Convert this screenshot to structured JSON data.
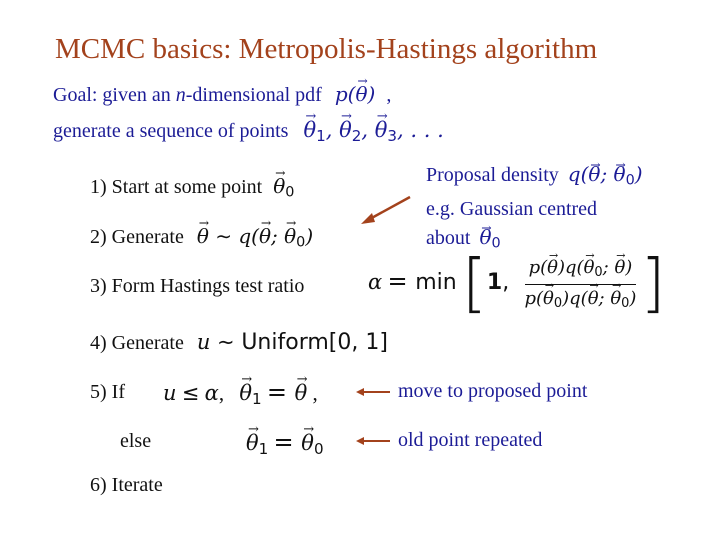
{
  "title": "MCMC basics:  Metropolis-Hastings algorithm",
  "goal": {
    "line1_prefix": "Goal:  given an ",
    "line1_n": "n",
    "line1_suffix": "-dimensional pdf",
    "line1_math": "p(θ)",
    "line1_comma": ",",
    "line2_text": "generate a sequence of points",
    "line2_math": "θ1, θ2, θ3, . . ."
  },
  "steps": [
    {
      "label": "1)  Start at some point",
      "math": "θ0"
    },
    {
      "label": "2)  Generate",
      "math": "θ ~ q(θ; θ0)"
    },
    {
      "label": "3)  Form Hastings test ratio",
      "math": "α = min[1, p(θ)q(θ0; θ) / p(θ0)q(θ; θ0)]"
    },
    {
      "label": "4)  Generate",
      "math": "u ~ Uniform[0, 1]"
    },
    {
      "label": "5)  If",
      "math": "u ≤ α,  θ1 = θ ,"
    },
    {
      "label": "else",
      "math": "θ1 = θ0"
    },
    {
      "label": "6)  Iterate",
      "math": ""
    }
  ],
  "annotations": {
    "proposal_line1": "Proposal density",
    "proposal_math": "q(θ; θ0)",
    "proposal_line2": "e.g. Gaussian centred",
    "proposal_line3": "about",
    "proposal_line3_math": "θ0",
    "accept_note": "move to proposed point",
    "reject_note": "old point repeated"
  },
  "math_tokens": {
    "p": "p",
    "q": "q",
    "theta": "θ",
    "sub0": "0",
    "sub1": "1",
    "sub2": "2",
    "sub3": "3",
    "tilde": "∼",
    "alpha": "α",
    "eq": "=",
    "min": "min",
    "one": "1",
    "u": "u",
    "leq": "≤",
    "uniform": "Uniform[0, 1]",
    "ellipsis": ". . ."
  },
  "colors": {
    "title": "#a3421c",
    "annotation_text": "#1c1c96",
    "body_text": "#111111",
    "arrow": "#a3421c"
  }
}
